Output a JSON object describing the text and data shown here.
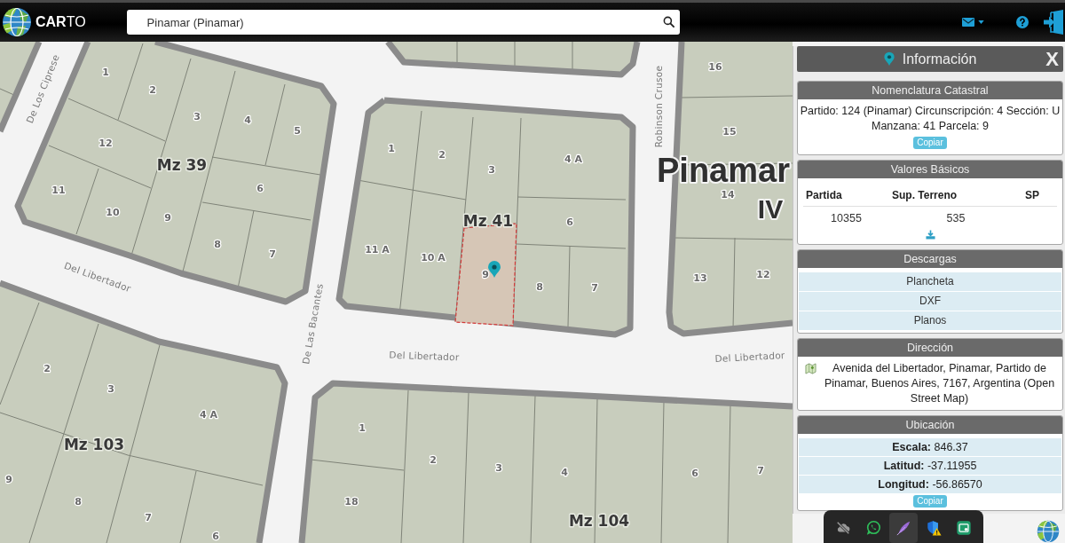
{
  "header": {
    "logo": "**CAR**TO",
    "search": {
      "value": "Pinamar (Pinamar)"
    }
  },
  "map": {
    "blocks": [
      {
        "label": "Mz 39",
        "lots": [
          {
            "number": "1",
            "selected": false
          },
          {
            "number": "2",
            "selected": false
          },
          {
            "number": "3",
            "selected": false
          },
          {
            "number": "4",
            "selected": false
          },
          {
            "number": "5",
            "selected": false
          },
          {
            "number": "12",
            "selected": false
          },
          {
            "number": "6",
            "selected": false
          },
          {
            "number": "11",
            "selected": false
          },
          {
            "number": "10",
            "selected": false
          },
          {
            "number": "9",
            "selected": false
          },
          {
            "number": "8",
            "selected": false
          },
          {
            "number": "7",
            "selected": false
          }
        ]
      },
      {
        "label": "Mz 41",
        "lots": [
          {
            "number": "1",
            "selected": false
          },
          {
            "number": "2",
            "selected": false
          },
          {
            "number": "3",
            "selected": false
          },
          {
            "number": "4 A",
            "selected": false
          },
          {
            "number": "6",
            "selected": false
          },
          {
            "number": "11 A",
            "selected": false
          },
          {
            "number": "10 A",
            "selected": false
          },
          {
            "number": "9",
            "selected": true
          },
          {
            "number": "8",
            "selected": false
          },
          {
            "number": "7",
            "selected": false
          }
        ]
      },
      {
        "lots": [
          {
            "number": "16",
            "selected": false
          },
          {
            "number": "15",
            "selected": false
          },
          {
            "number": "14",
            "selected": false
          },
          {
            "number": "13",
            "selected": false
          },
          {
            "number": "12",
            "selected": false
          }
        ]
      },
      {
        "label": "Mz 103",
        "lots": [
          {
            "number": "2",
            "selected": false
          },
          {
            "number": "3",
            "selected": false
          },
          {
            "number": "4 A",
            "selected": false
          },
          {
            "number": "9",
            "selected": false
          },
          {
            "number": "8",
            "selected": false
          },
          {
            "number": "7",
            "selected": false
          },
          {
            "number": "6",
            "selected": false
          }
        ]
      },
      {
        "label": "Mz 104",
        "lots": [
          {
            "number": "1",
            "selected": false
          },
          {
            "number": "2",
            "selected": false
          },
          {
            "number": "3",
            "selected": false
          },
          {
            "number": "4",
            "selected": false
          },
          {
            "number": "6",
            "selected": false
          },
          {
            "number": "7",
            "selected": false
          },
          {
            "number": "18",
            "selected": false
          }
        ]
      }
    ],
    "streets": [
      "De Los Ciprese",
      "Del Libertador",
      "De Las Bacantes",
      "Robinson Crusoe",
      "Del Libertador",
      "Del Libertador"
    ],
    "place_labels": [
      "Pinamar",
      "IV"
    ]
  },
  "info_panel": {
    "title": "Información",
    "close": "X",
    "sections": [
      {
        "kind": "text",
        "title": "Nomenclatura Catastral",
        "text": "Partido: 124 (Pinamar) Circunscripción: 4 Sección: U Manzana: 41 Parcela: 9",
        "button": "Copiar"
      },
      {
        "kind": "table",
        "title": "Valores Básicos",
        "columns": [
          "Partida",
          "Sup. Terreno",
          "SP"
        ],
        "rows": [
          [
            "10355",
            "535"
          ]
        ]
      },
      {
        "kind": "links",
        "title": "Descargas",
        "items": [
          "Plancheta",
          "DXF",
          "Planos"
        ]
      },
      {
        "kind": "address",
        "title": "Dirección",
        "text": "Avenida del Libertador, Pinamar, Partido de Pinamar, Buenos Aires, 7167, Argentina (Open Street Map)"
      },
      {
        "kind": "values",
        "title": "Ubicación",
        "items": [
          "**Escala:** 846.37",
          "**Latitud:** -37.11955",
          "**Longitud:** -56.86570"
        ],
        "button": "Copiar"
      }
    ]
  },
  "tray": {
    "icons": [
      {
        "kind": "cloud-off",
        "selected": false
      },
      {
        "kind": "chat",
        "selected": false
      },
      {
        "kind": "feather",
        "selected": true
      },
      {
        "kind": "shield",
        "selected": false
      },
      {
        "kind": "card",
        "selected": false
      }
    ]
  }
}
